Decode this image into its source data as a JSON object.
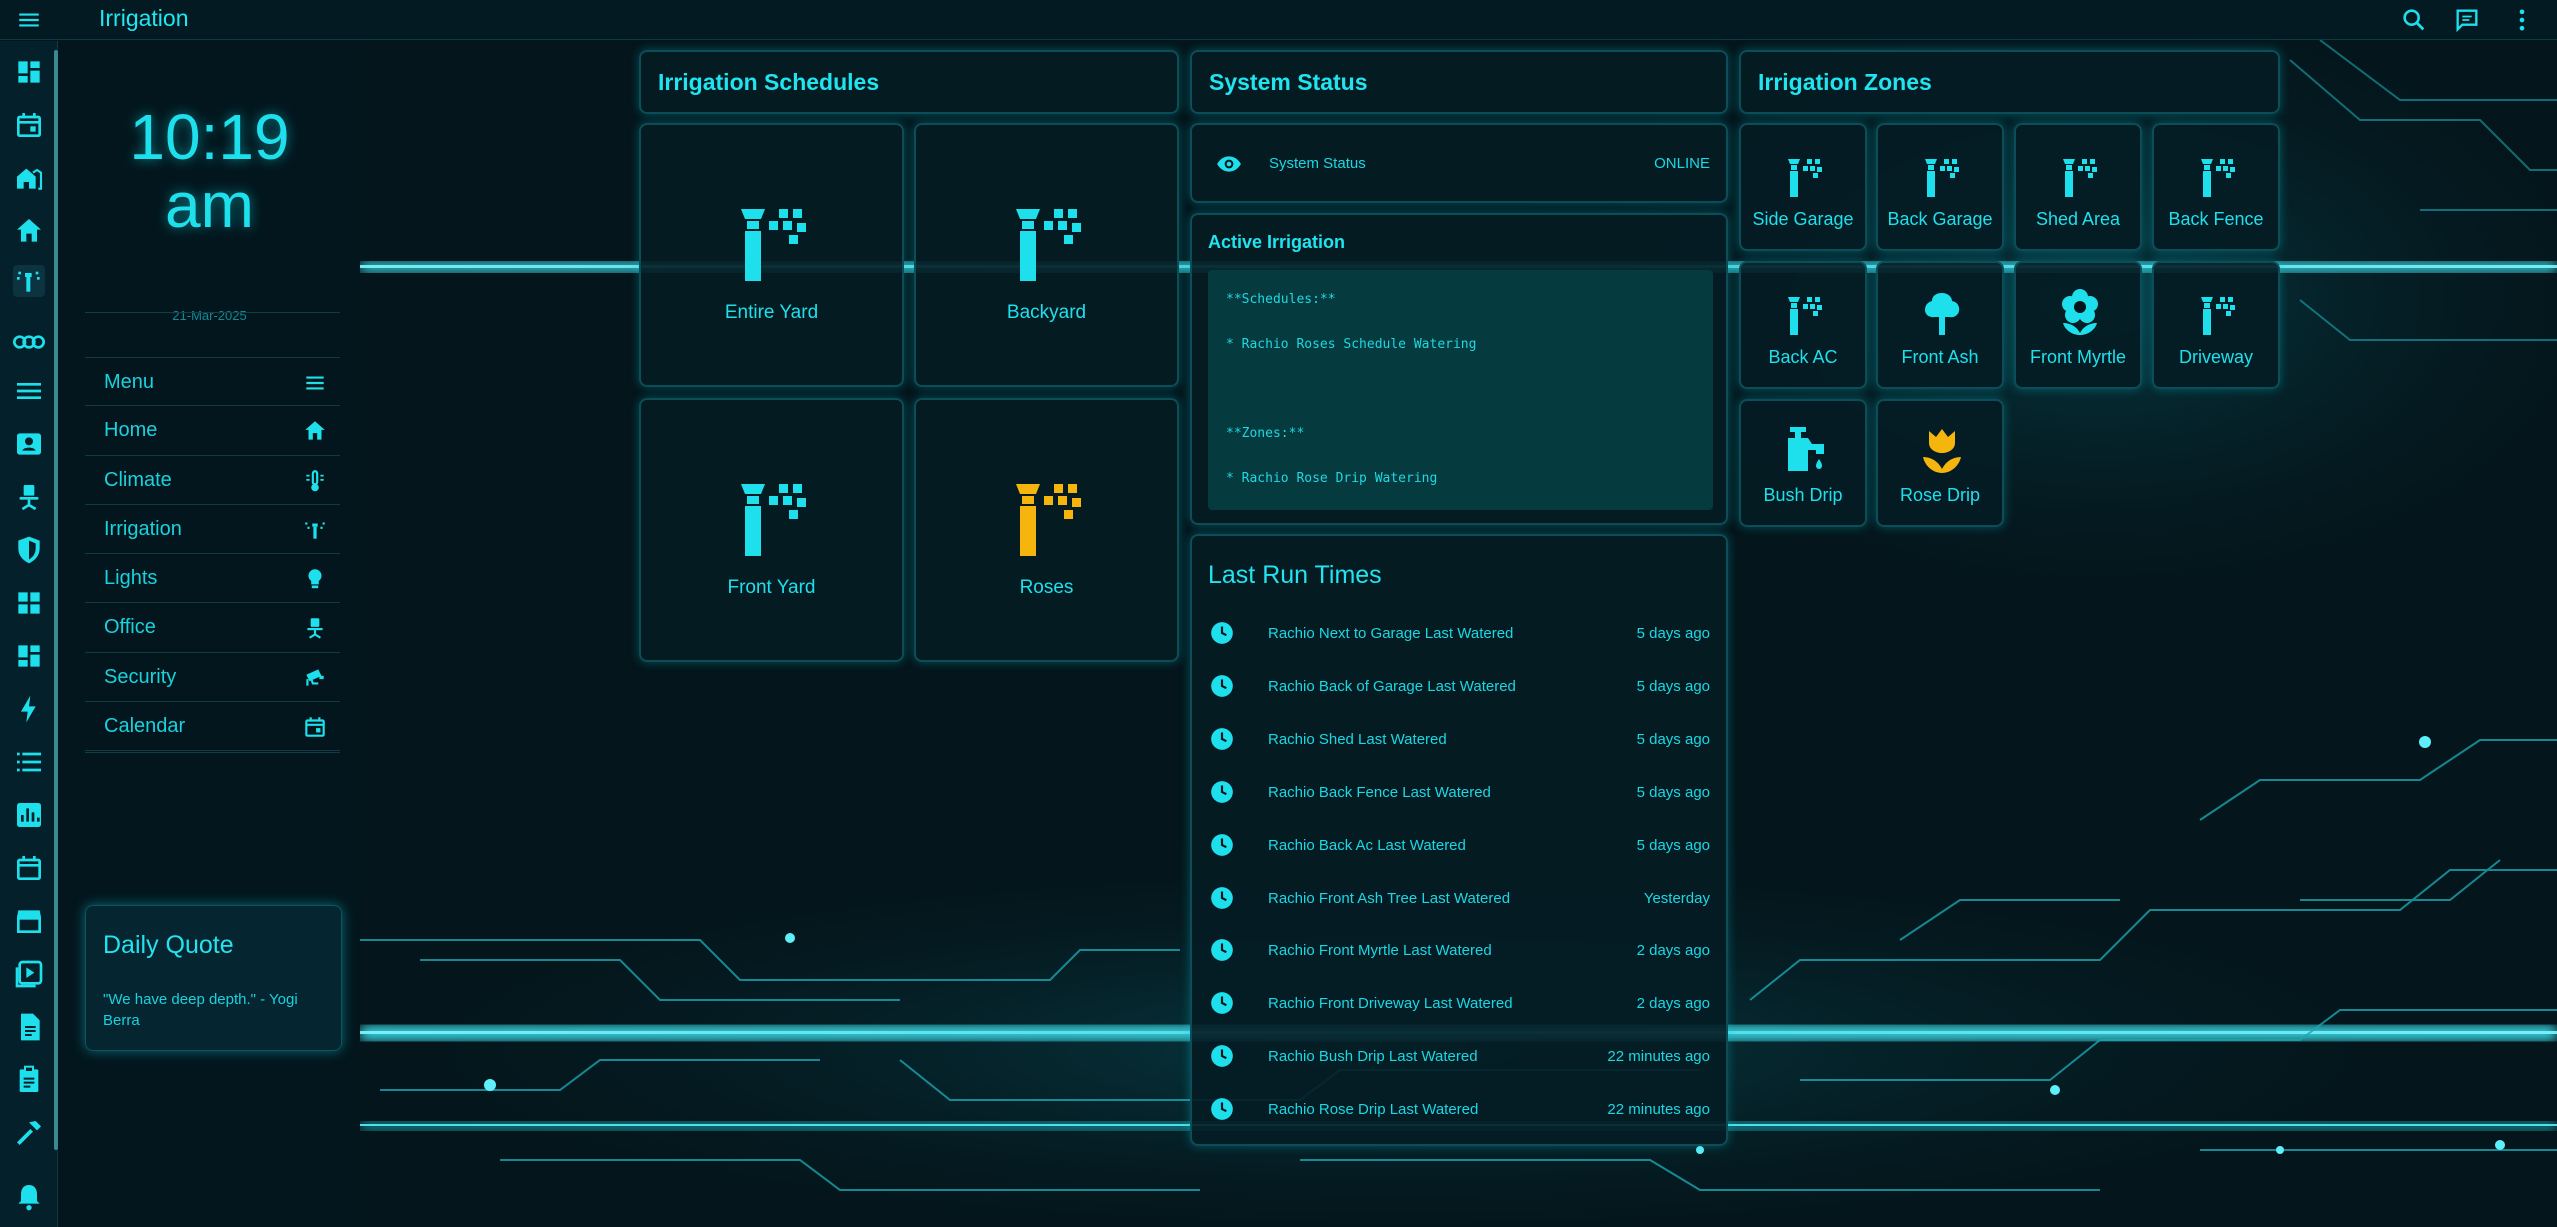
{
  "app": {
    "title": "Irrigation"
  },
  "clock": {
    "time_line1": "10:19",
    "time_line2": "am",
    "date": "21-Mar-2025"
  },
  "nav": {
    "items": [
      {
        "label": "Menu",
        "icon": "hamburger-icon"
      },
      {
        "label": "Home",
        "icon": "home-icon"
      },
      {
        "label": "Climate",
        "icon": "thermometer-icon"
      },
      {
        "label": "Irrigation",
        "icon": "sprinkler-icon"
      },
      {
        "label": "Lights",
        "icon": "lightbulb-icon"
      },
      {
        "label": "Office",
        "icon": "desk-chair-icon"
      },
      {
        "label": "Security",
        "icon": "cctv-icon"
      },
      {
        "label": "Calendar",
        "icon": "calendar-icon"
      }
    ]
  },
  "quote": {
    "title": "Daily Quote",
    "text": "\"We have deep depth.\" - Yogi Berra"
  },
  "schedules": {
    "title": "Irrigation Schedules",
    "tiles": [
      {
        "label": "Entire Yard",
        "active": false
      },
      {
        "label": "Backyard",
        "active": false
      },
      {
        "label": "Front Yard",
        "active": false
      },
      {
        "label": "Roses",
        "active": true
      }
    ]
  },
  "status": {
    "title": "System Status",
    "row_label": "System Status",
    "row_value": "ONLINE"
  },
  "active": {
    "title": "Active Irrigation",
    "lines": [
      "**Schedules:**",
      "* Rachio Roses Schedule Watering",
      "**Zones:**",
      "* Rachio Rose Drip Watering"
    ]
  },
  "lastrun": {
    "title": "Last Run Times",
    "rows": [
      {
        "name": "Rachio Next to Garage Last Watered",
        "value": "5 days ago"
      },
      {
        "name": "Rachio Back of Garage Last Watered",
        "value": "5 days ago"
      },
      {
        "name": "Rachio Shed Last Watered",
        "value": "5 days ago"
      },
      {
        "name": "Rachio Back Fence Last Watered",
        "value": "5 days ago"
      },
      {
        "name": "Rachio Back Ac Last Watered",
        "value": "5 days ago"
      },
      {
        "name": "Rachio Front Ash Tree Last Watered",
        "value": "Yesterday"
      },
      {
        "name": "Rachio Front Myrtle Last Watered",
        "value": "2 days ago"
      },
      {
        "name": "Rachio Front Driveway Last Watered",
        "value": "2 days ago"
      },
      {
        "name": "Rachio Bush Drip Last Watered",
        "value": "22 minutes ago"
      },
      {
        "name": "Rachio Rose Drip Last Watered",
        "value": "22 minutes ago"
      }
    ]
  },
  "zones": {
    "title": "Irrigation Zones",
    "tiles": [
      {
        "label": "Side Garage",
        "icon": "sprinkler-icon",
        "active": false
      },
      {
        "label": "Back Garage",
        "icon": "sprinkler-icon",
        "active": false
      },
      {
        "label": "Shed Area",
        "icon": "sprinkler-icon",
        "active": false
      },
      {
        "label": "Back Fence",
        "icon": "sprinkler-icon",
        "active": false
      },
      {
        "label": "Back AC",
        "icon": "sprinkler-icon",
        "active": false
      },
      {
        "label": "Front Ash",
        "icon": "tree-icon",
        "active": false
      },
      {
        "label": "Front Myrtle",
        "icon": "flower-icon",
        "active": false
      },
      {
        "label": "Driveway",
        "icon": "sprinkler-icon",
        "active": false
      },
      {
        "label": "Bush Drip",
        "icon": "water-pump-icon",
        "active": false
      },
      {
        "label": "Rose Drip",
        "icon": "tulip-icon",
        "active": true
      }
    ]
  },
  "colors": {
    "accent": "#1ee0ec",
    "active": "#f5b50d",
    "background": "#04151b"
  }
}
